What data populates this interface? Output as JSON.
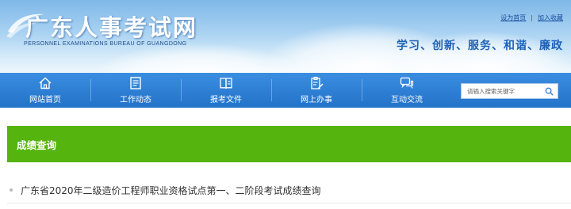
{
  "header": {
    "title": "广东人事考试网",
    "subtitle": "PERSONNEL EXAMINATIONS BUREAU OF GUANGDONG",
    "links": [
      "设为首页",
      "加入收藏"
    ],
    "link_separator": "|",
    "slogan": "学习、创新、服务、和谐、廉政"
  },
  "nav": {
    "items": [
      {
        "label": "网站首页",
        "icon": "home-icon"
      },
      {
        "label": "工作动态",
        "icon": "news-icon"
      },
      {
        "label": "报考文件",
        "icon": "book-icon"
      },
      {
        "label": "网上办事",
        "icon": "clipboard-edit-icon"
      },
      {
        "label": "互动交流",
        "icon": "chat-icon"
      }
    ],
    "search": {
      "placeholder": "请输入搜索关键字",
      "icon": "search-icon"
    }
  },
  "section": {
    "title": "成绩查询",
    "items": [
      {
        "text": "广东省2020年二级造价工程师职业资格试点第一、二阶段考试成绩查询"
      }
    ]
  },
  "colors": {
    "nav": "#2a7cd4",
    "section": "#55b40e",
    "slogan": "#1d62b6"
  }
}
